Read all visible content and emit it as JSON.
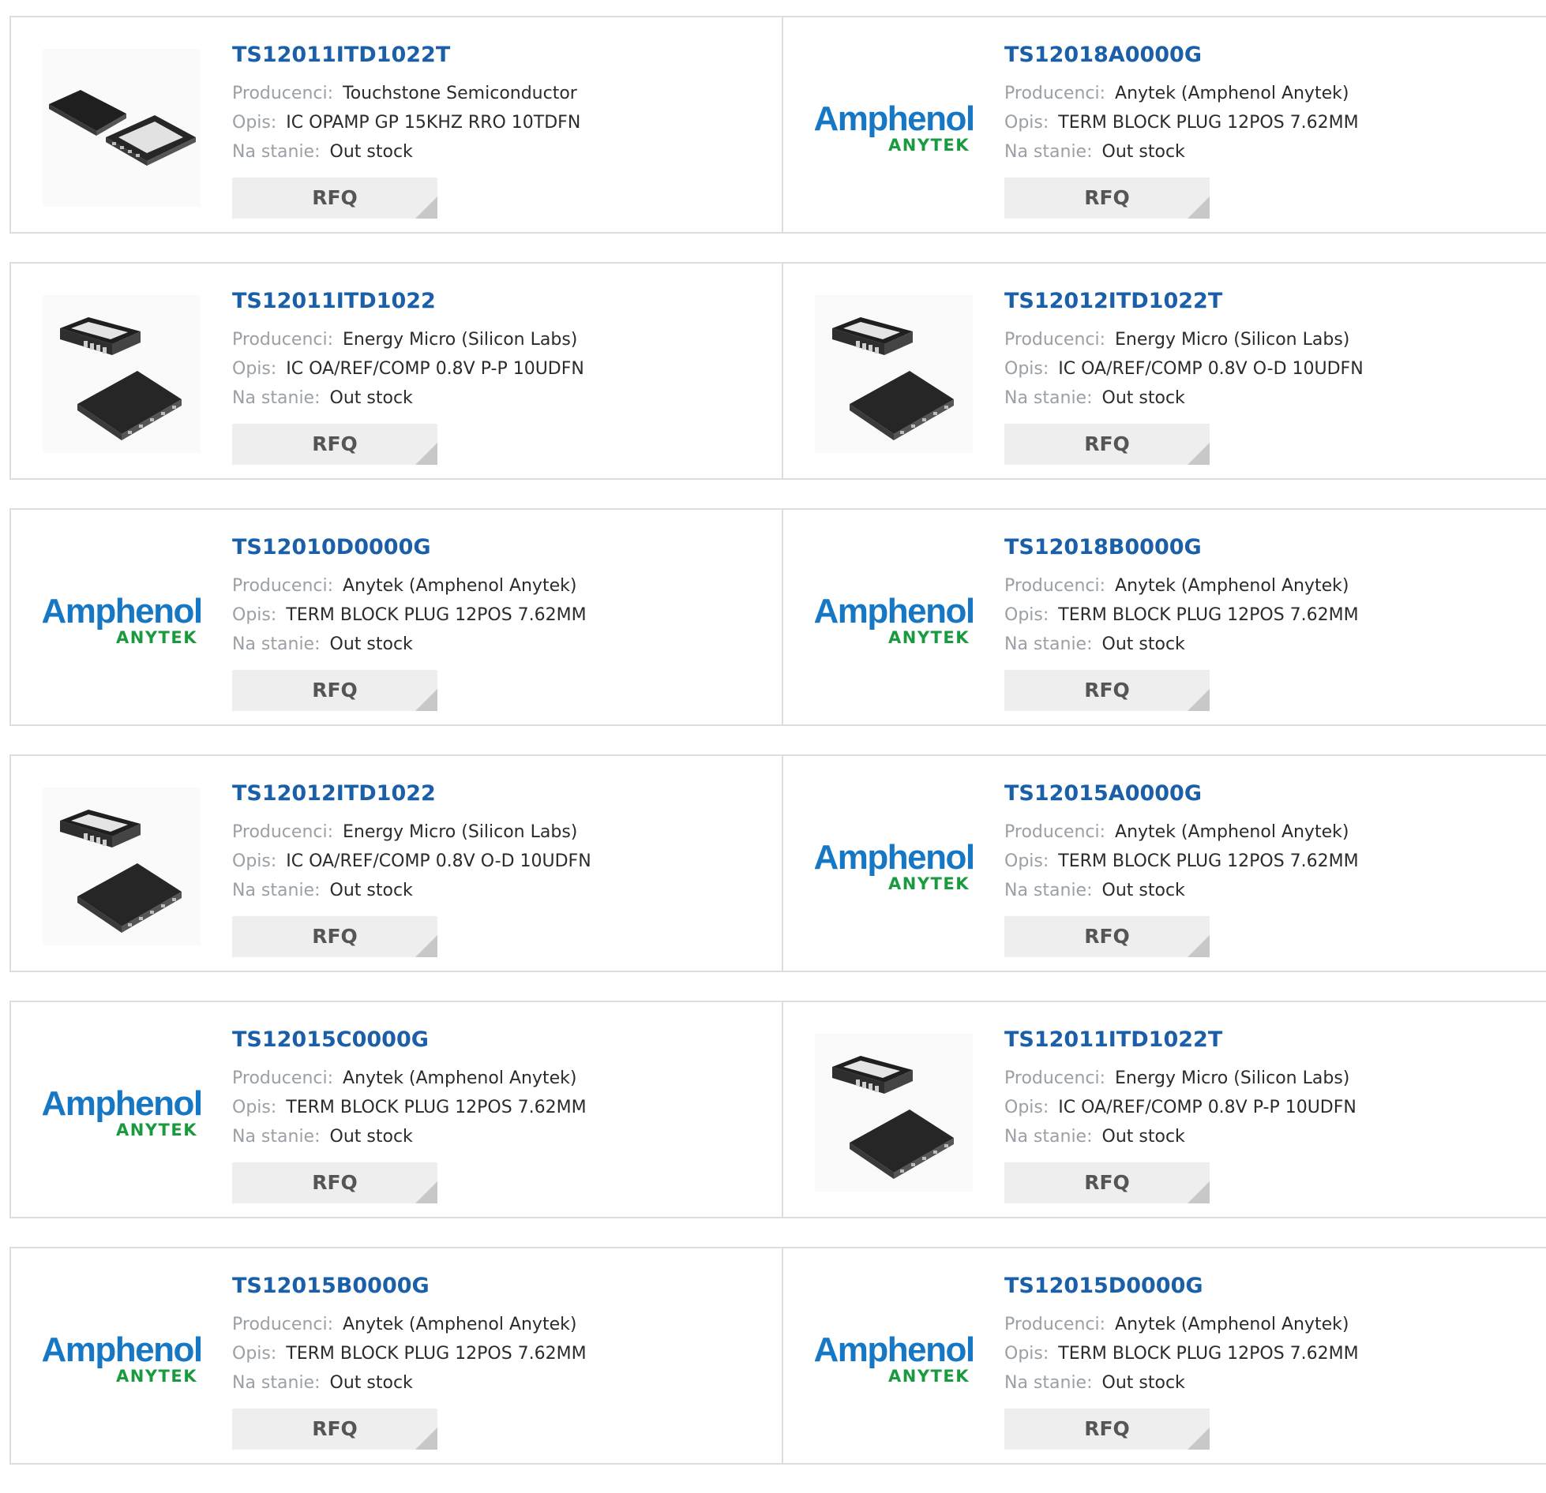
{
  "labels": {
    "manufacturer": "Producenci:",
    "description": "Opis:",
    "stock": "Na stanie:",
    "rfq": "RFQ"
  },
  "logo": {
    "brand": "Amphenol",
    "sub": "ANYTEK",
    "brand_color": "#1677c4",
    "sub_color": "#1a9a3e"
  },
  "colors": {
    "part_link": "#1a5fa8",
    "label": "#9aa0a6",
    "value": "#2b2b2b",
    "rfq_bg": "#eeeeee",
    "border": "#dddddd"
  },
  "products": [
    {
      "part": "TS12011ITD1022T",
      "manufacturer": "Touchstone Semiconductor",
      "description": "IC OPAMP GP 15KHZ RRO 10TDFN",
      "stock": "Out stock",
      "image": "ic-pair-side"
    },
    {
      "part": "TS12018A0000G",
      "manufacturer": "Anytek (Amphenol Anytek)",
      "description": "TERM BLOCK PLUG 12POS 7.62MM",
      "stock": "Out stock",
      "image": "amphenol-logo"
    },
    {
      "part": "TS12011ITD1022",
      "manufacturer": "Energy Micro (Silicon Labs)",
      "description": "IC OA/REF/COMP 0.8V P-P 10UDFN",
      "stock": "Out stock",
      "image": "ic-pair-stacked"
    },
    {
      "part": "TS12012ITD1022T",
      "manufacturer": "Energy Micro (Silicon Labs)",
      "description": "IC OA/REF/COMP 0.8V O-D 10UDFN",
      "stock": "Out stock",
      "image": "ic-pair-stacked"
    },
    {
      "part": "TS12010D0000G",
      "manufacturer": "Anytek (Amphenol Anytek)",
      "description": "TERM BLOCK PLUG 12POS 7.62MM",
      "stock": "Out stock",
      "image": "amphenol-logo"
    },
    {
      "part": "TS12018B0000G",
      "manufacturer": "Anytek (Amphenol Anytek)",
      "description": "TERM BLOCK PLUG 12POS 7.62MM",
      "stock": "Out stock",
      "image": "amphenol-logo"
    },
    {
      "part": "TS12012ITD1022",
      "manufacturer": "Energy Micro (Silicon Labs)",
      "description": "IC OA/REF/COMP 0.8V O-D 10UDFN",
      "stock": "Out stock",
      "image": "ic-pair-stacked"
    },
    {
      "part": "TS12015A0000G",
      "manufacturer": "Anytek (Amphenol Anytek)",
      "description": "TERM BLOCK PLUG 12POS 7.62MM",
      "stock": "Out stock",
      "image": "amphenol-logo"
    },
    {
      "part": "TS12015C0000G",
      "manufacturer": "Anytek (Amphenol Anytek)",
      "description": "TERM BLOCK PLUG 12POS 7.62MM",
      "stock": "Out stock",
      "image": "amphenol-logo"
    },
    {
      "part": "TS12011ITD1022T",
      "manufacturer": "Energy Micro (Silicon Labs)",
      "description": "IC OA/REF/COMP 0.8V P-P 10UDFN",
      "stock": "Out stock",
      "image": "ic-pair-stacked"
    },
    {
      "part": "TS12015B0000G",
      "manufacturer": "Anytek (Amphenol Anytek)",
      "description": "TERM BLOCK PLUG 12POS 7.62MM",
      "stock": "Out stock",
      "image": "amphenol-logo"
    },
    {
      "part": "TS12015D0000G",
      "manufacturer": "Anytek (Amphenol Anytek)",
      "description": "TERM BLOCK PLUG 12POS 7.62MM",
      "stock": "Out stock",
      "image": "amphenol-logo"
    }
  ]
}
